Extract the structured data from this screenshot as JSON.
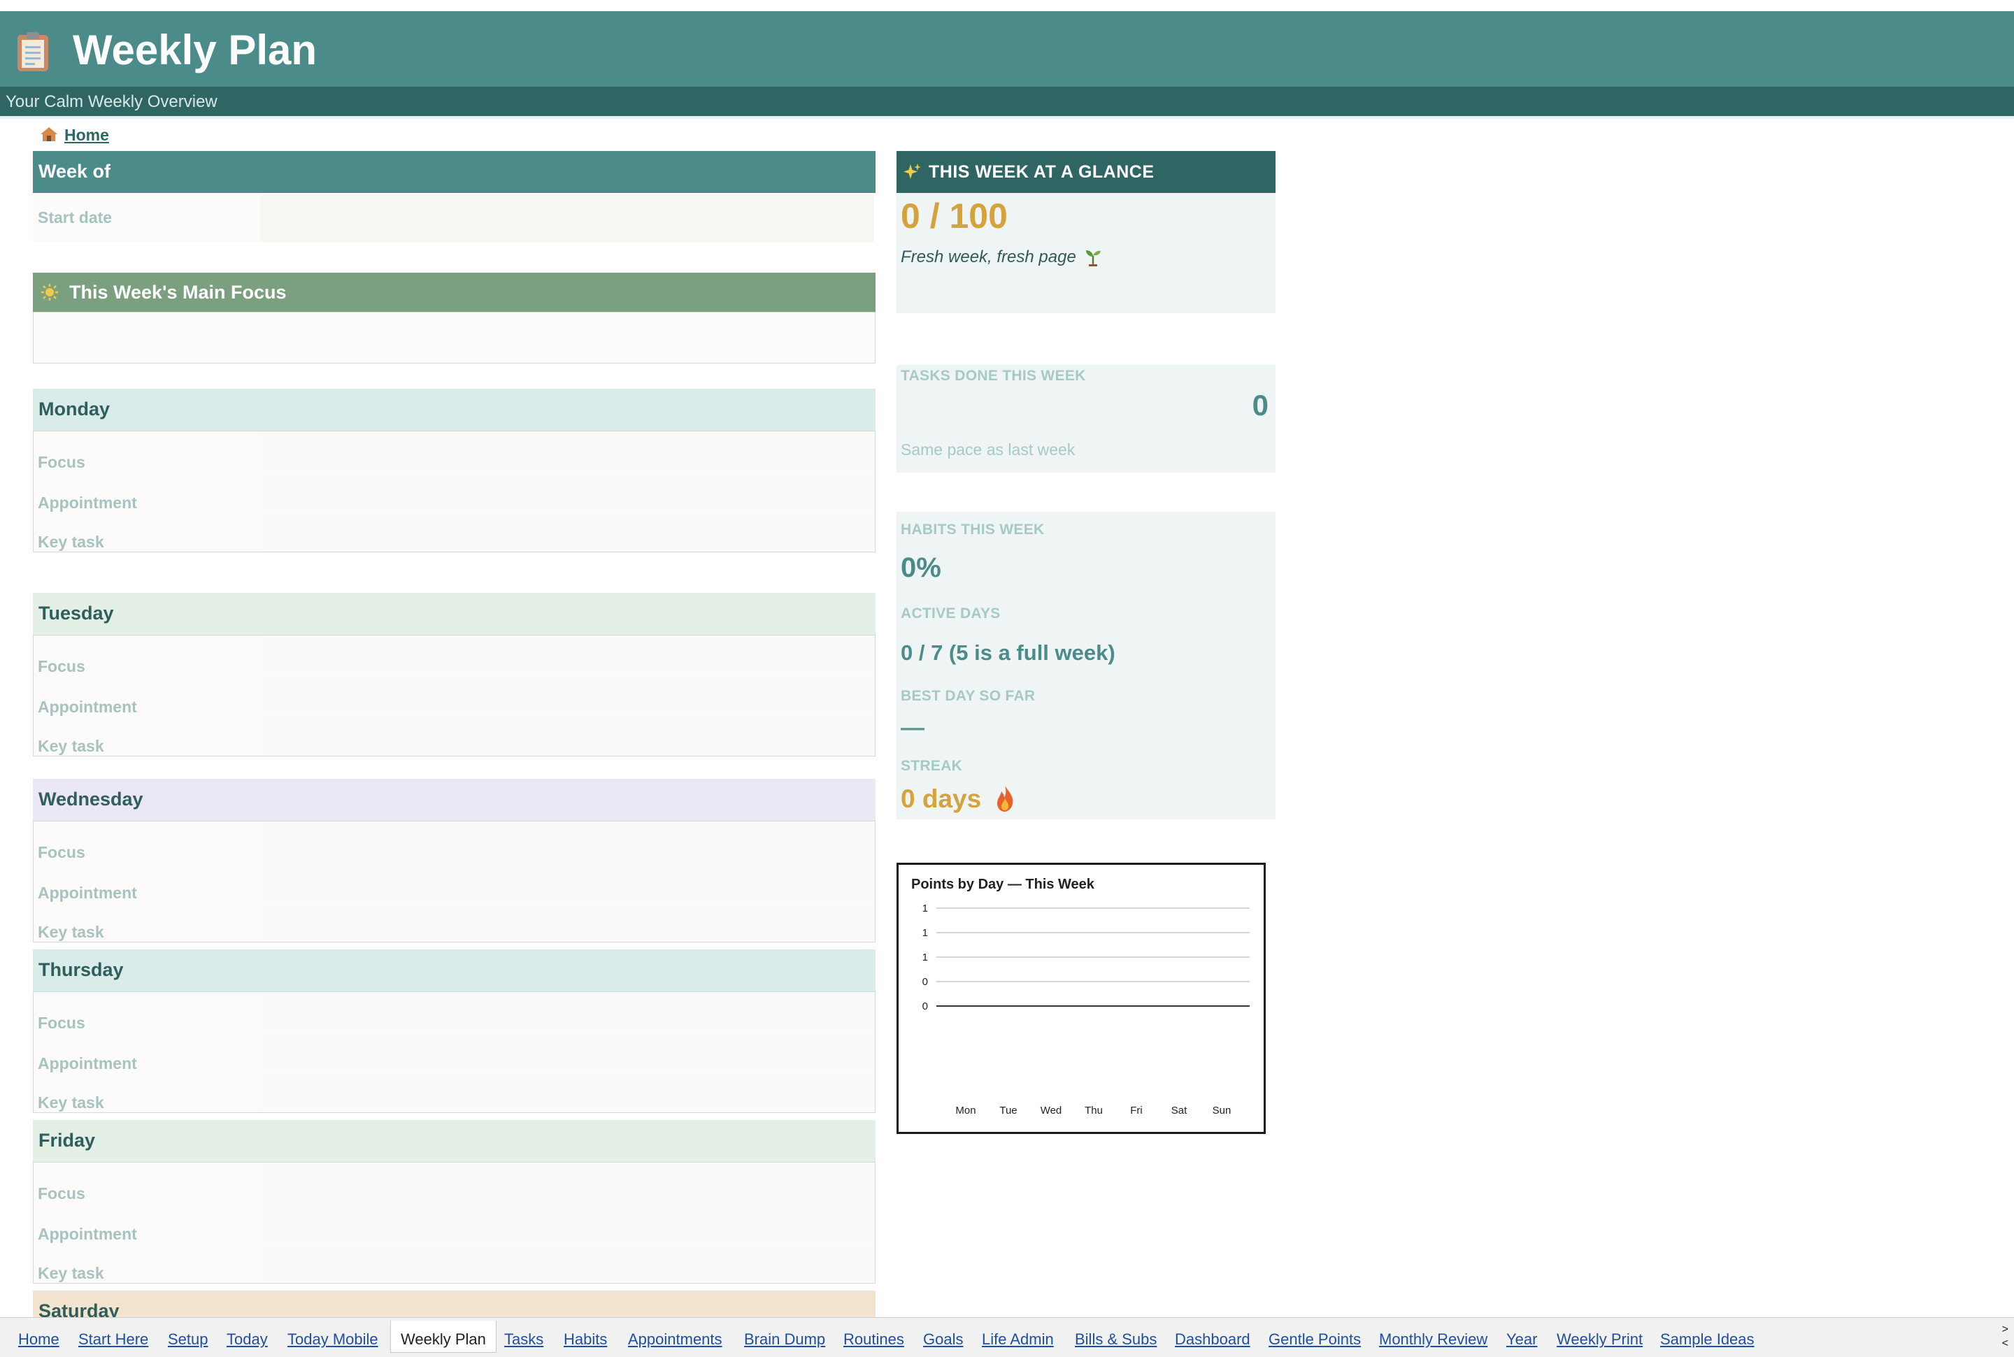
{
  "header": {
    "title": "Weekly Plan",
    "subtitle": "Your Calm Weekly Overview"
  },
  "home_link": "Home",
  "week_of": {
    "title": "Week of",
    "start_label": "Start date"
  },
  "main_focus": {
    "title": "This Week's Main Focus"
  },
  "days": [
    {
      "name": "Monday",
      "color": "#d9ecea"
    },
    {
      "name": "Tuesday",
      "color": "#e4efe5"
    },
    {
      "name": "Wednesday",
      "color": "#ebe7f5"
    },
    {
      "name": "Thursday",
      "color": "#d9ecea"
    },
    {
      "name": "Friday",
      "color": "#e4efe5"
    },
    {
      "name": "Saturday",
      "color": "#f2e4cf"
    }
  ],
  "day_fields": [
    "Focus",
    "Appointment",
    "Key task"
  ],
  "glance": {
    "title": "THIS WEEK AT A GLANCE",
    "points": "0 / 100",
    "message": "Fresh week, fresh page",
    "tasks_label": "TASKS DONE THIS WEEK",
    "tasks_value": "0",
    "tasks_note": "Same pace as last week",
    "habits_label": "HABITS THIS WEEK",
    "habits_value": "0%",
    "active_label": "ACTIVE DAYS",
    "active_value": "0 / 7 (5 is a full week)",
    "best_label": "BEST DAY SO FAR",
    "best_value": "—",
    "streak_label": "STREAK",
    "streak_value": "0 days"
  },
  "chart_data": {
    "type": "bar",
    "title": "Points by Day — This Week",
    "categories": [
      "Mon",
      "Tue",
      "Wed",
      "Thu",
      "Fri",
      "Sat",
      "Sun"
    ],
    "values": [
      0,
      0,
      0,
      0,
      0,
      0,
      0
    ],
    "y_tick_labels": [
      "1",
      "1",
      "1",
      "0",
      "0"
    ],
    "grid": true
  },
  "tabs": [
    "Home",
    "Start Here",
    "Setup",
    "Today",
    "Today Mobile",
    "Weekly Plan",
    "Tasks",
    "Habits",
    "Appointments",
    "Brain Dump",
    "Routines",
    "Goals",
    "Life Admin",
    "Bills & Subs",
    "Dashboard",
    "Gentle Points",
    "Monthly Review",
    "Year",
    "Weekly Print",
    "Sample Ideas"
  ],
  "active_tab": "Weekly Plan",
  "colors": {
    "header": "#4b8b8a",
    "subbar": "#2f6664",
    "focus_header": "#7ba07f",
    "accent_gold": "#d4a33b",
    "teal_text": "#2f6664"
  }
}
